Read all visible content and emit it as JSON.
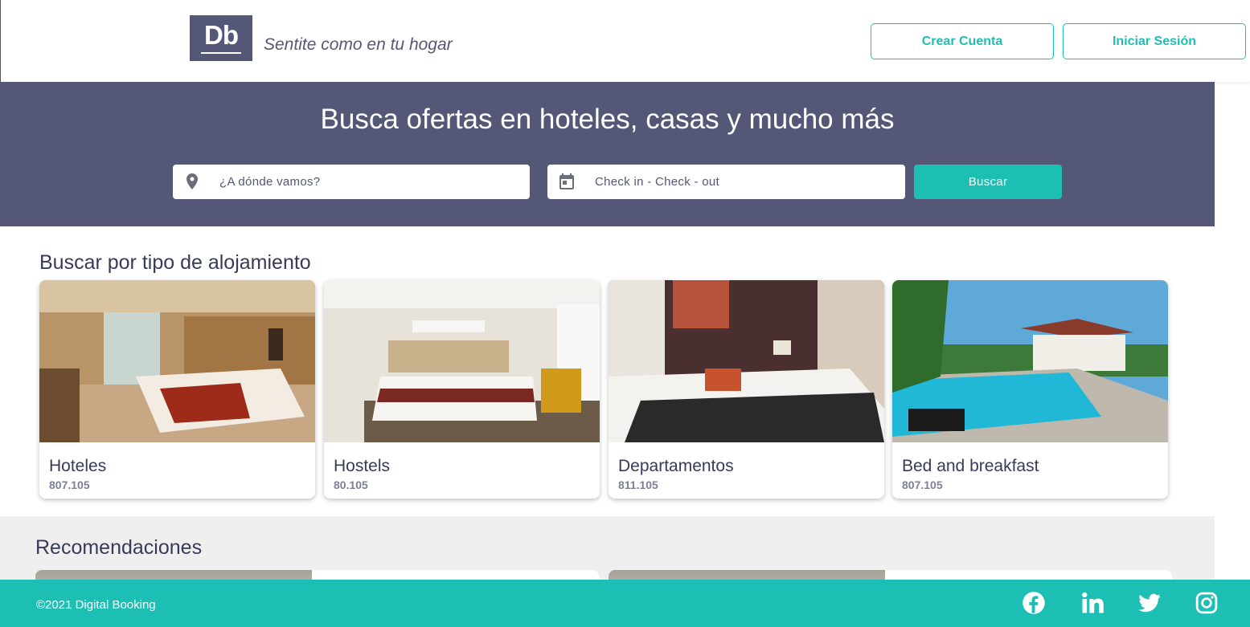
{
  "header": {
    "logo_text": "Db",
    "slogan": "Sentite como en tu hogar",
    "create_account": "Crear Cuenta",
    "login": "Iniciar Sesión"
  },
  "search": {
    "title": "Busca ofertas en hoteles, casas y mucho más",
    "destination_placeholder": "¿A dónde vamos?",
    "dates_placeholder": "Check in - Check - out",
    "button": "Buscar"
  },
  "categories": {
    "title": "Buscar por tipo de alojamiento",
    "items": [
      {
        "name": "Hoteles",
        "count": "807.105"
      },
      {
        "name": "Hostels",
        "count": "80.105"
      },
      {
        "name": "Departamentos",
        "count": "811.105"
      },
      {
        "name": "Bed and breakfast",
        "count": "807.105"
      }
    ]
  },
  "recommendations": {
    "title": "Recomendaciones"
  },
  "footer": {
    "copyright": "©2021 Digital Booking",
    "social": [
      "facebook-icon",
      "linkedin-icon",
      "twitter-icon",
      "instagram-icon"
    ]
  },
  "colors": {
    "primary": "#1dbeb4",
    "secondary": "#545776",
    "text": "#383b58"
  }
}
